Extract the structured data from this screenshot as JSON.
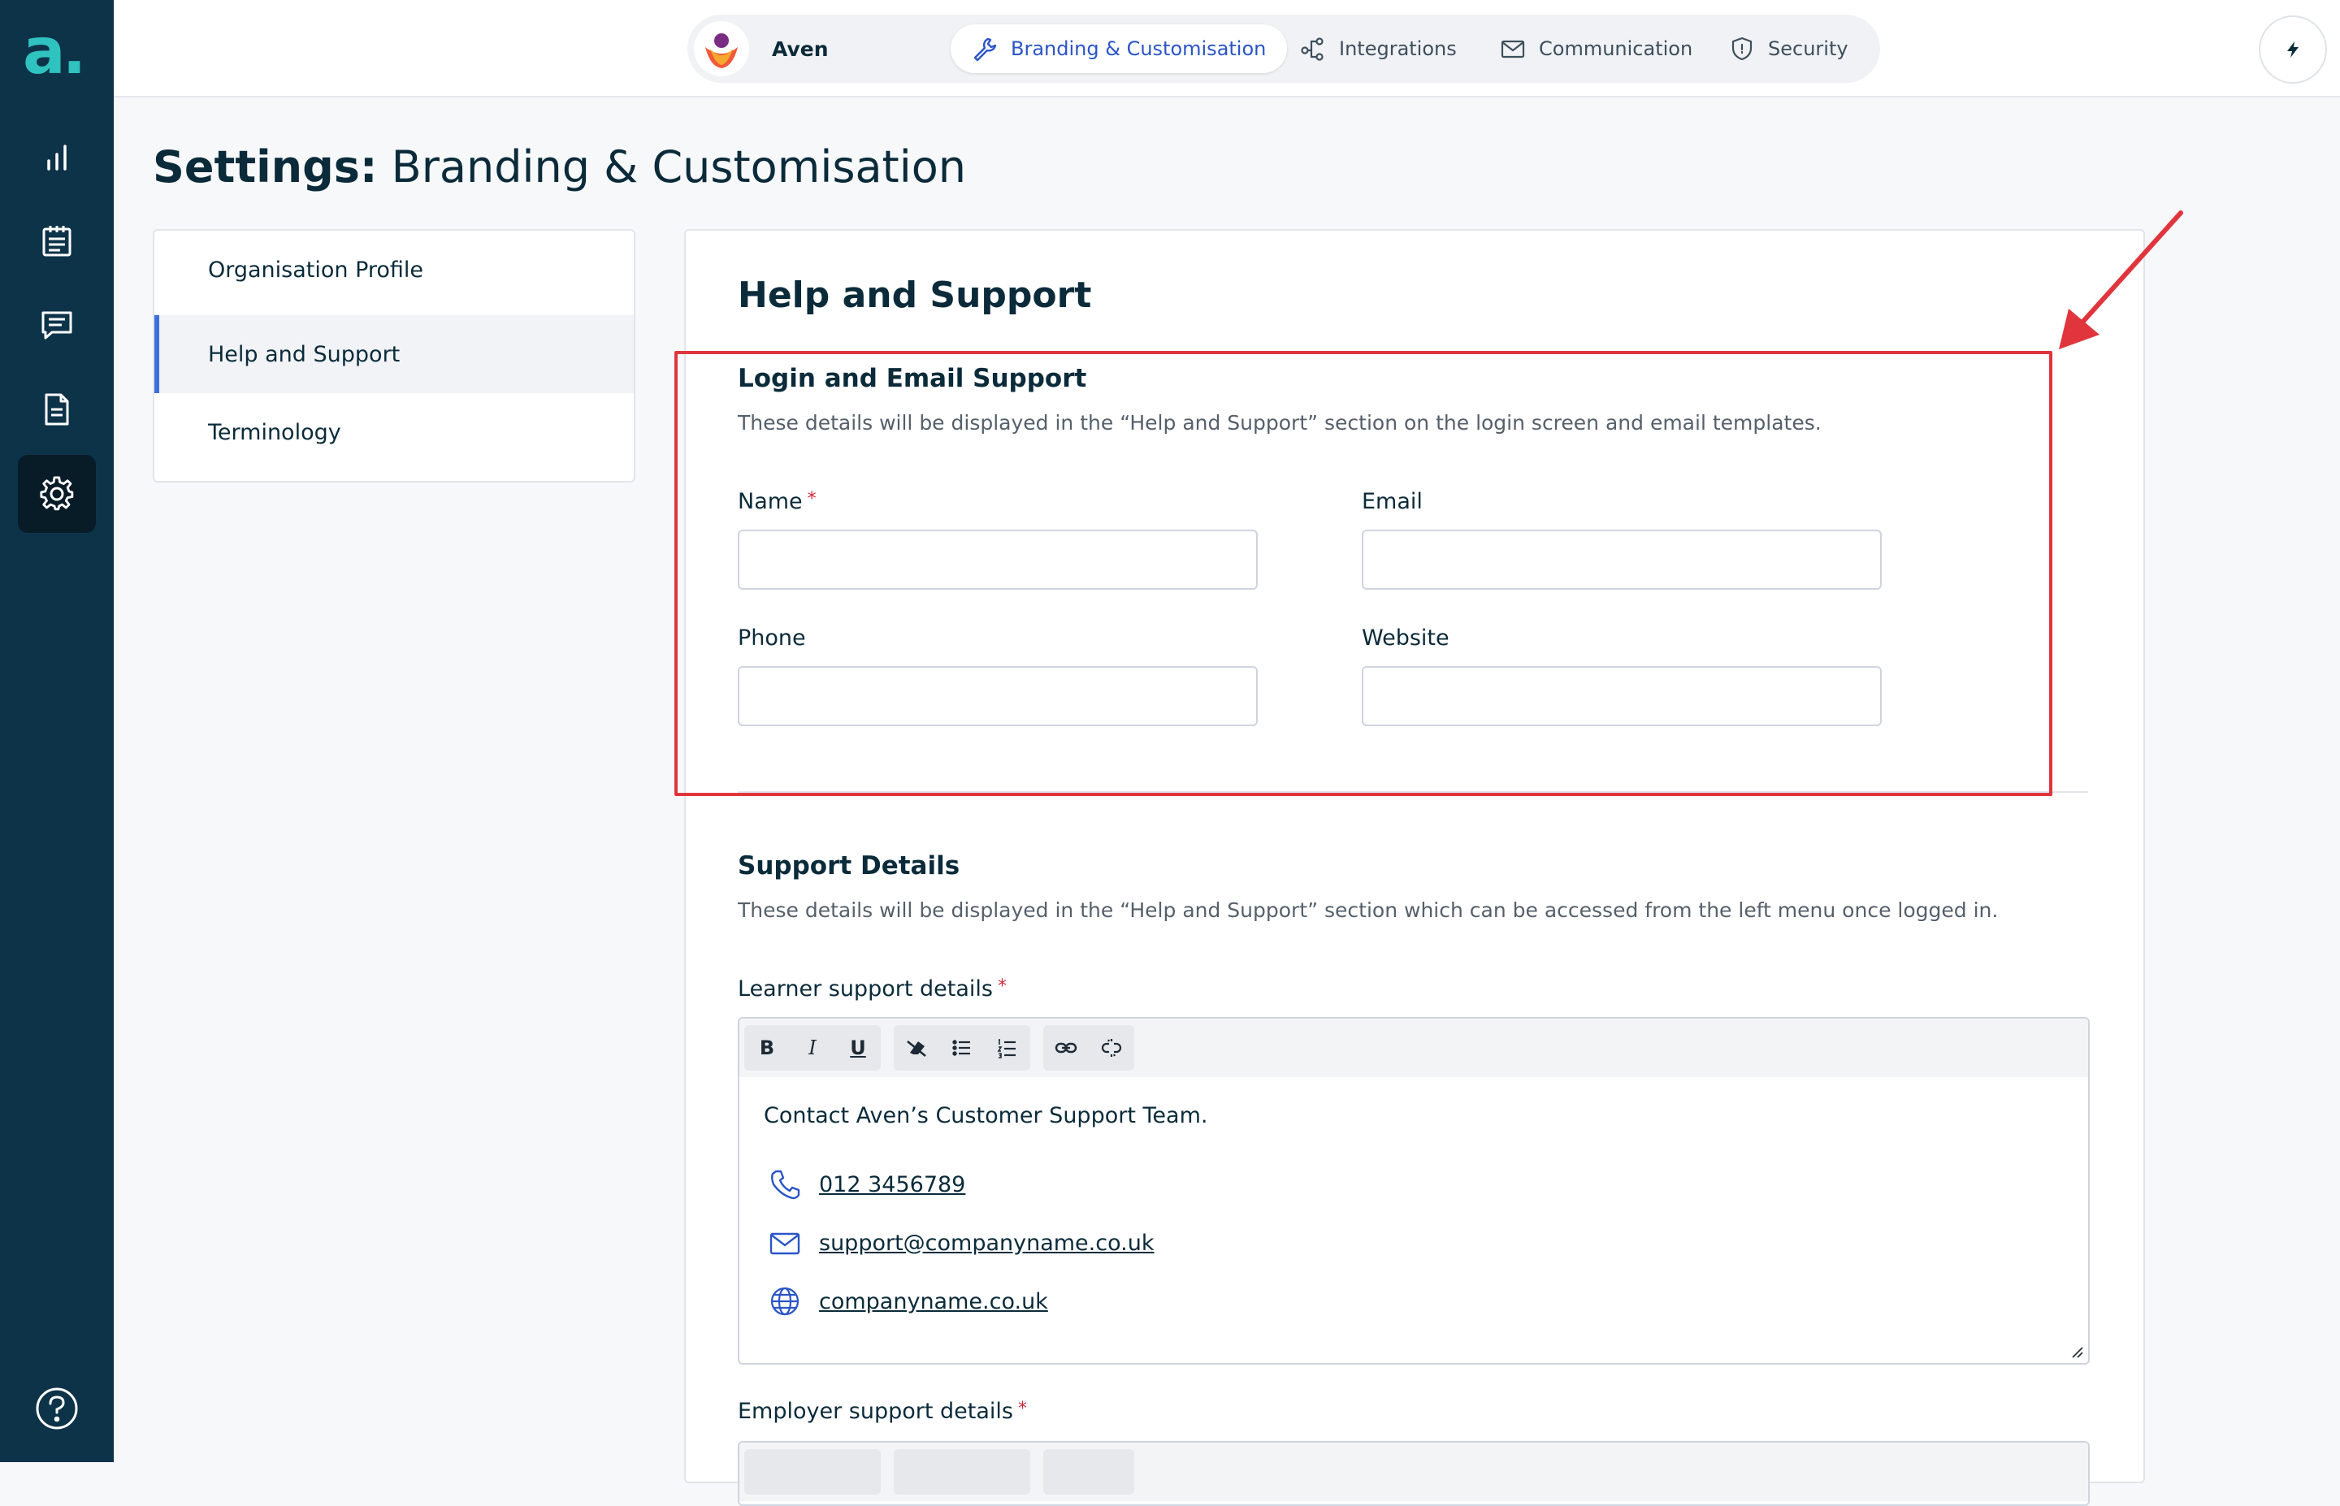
{
  "rail": {
    "logo": "a.",
    "items": [
      "analytics",
      "clipboard",
      "messages",
      "documents",
      "settings"
    ],
    "active": "settings"
  },
  "topbar": {
    "org_name": "Aven",
    "tabs": [
      {
        "label": "Branding & Customisation",
        "icon": "wrench-icon",
        "active": true
      },
      {
        "label": "Integrations",
        "icon": "integrations-icon",
        "active": false
      },
      {
        "label": "Communication",
        "icon": "envelope-icon",
        "active": false
      },
      {
        "label": "Security",
        "icon": "shield-icon",
        "active": false
      }
    ]
  },
  "page": {
    "title_prefix": "Settings:",
    "title_rest": " Branding & Customisation"
  },
  "subnav": {
    "items": [
      {
        "label": "Organisation Profile",
        "active": false
      },
      {
        "label": "Help and Support",
        "active": true
      },
      {
        "label": "Terminology",
        "active": false
      }
    ]
  },
  "content": {
    "heading": "Help and Support",
    "login_section": {
      "title": "Login and Email Support",
      "description": "These details will be displayed in the “Help and Support” section on the login screen and email templates.",
      "fields": {
        "name": {
          "label": "Name",
          "required": "*",
          "value": ""
        },
        "email": {
          "label": "Email",
          "value": ""
        },
        "phone": {
          "label": "Phone",
          "value": ""
        },
        "website": {
          "label": "Website",
          "value": ""
        }
      }
    },
    "support_section": {
      "title": "Support Details",
      "description": "These details will be displayed in the “Help and Support” section which can be accessed from the left menu once logged in.",
      "learner": {
        "label": "Learner support details",
        "required": "*",
        "intro": "Contact Aven’s Customer Support Team.",
        "phone": "012 3456789",
        "email": "support@companyname.co.uk",
        "website": "companyname.co.uk"
      },
      "employer": {
        "label": "Employer support details",
        "required": "*"
      }
    },
    "toolbar": {
      "bold": "B",
      "italic": "I",
      "underline": "U"
    }
  },
  "colors": {
    "rail": "#0d3349",
    "accent": "#2b55c7",
    "annotation": "#e0353d",
    "logo": "#2fc2be"
  }
}
